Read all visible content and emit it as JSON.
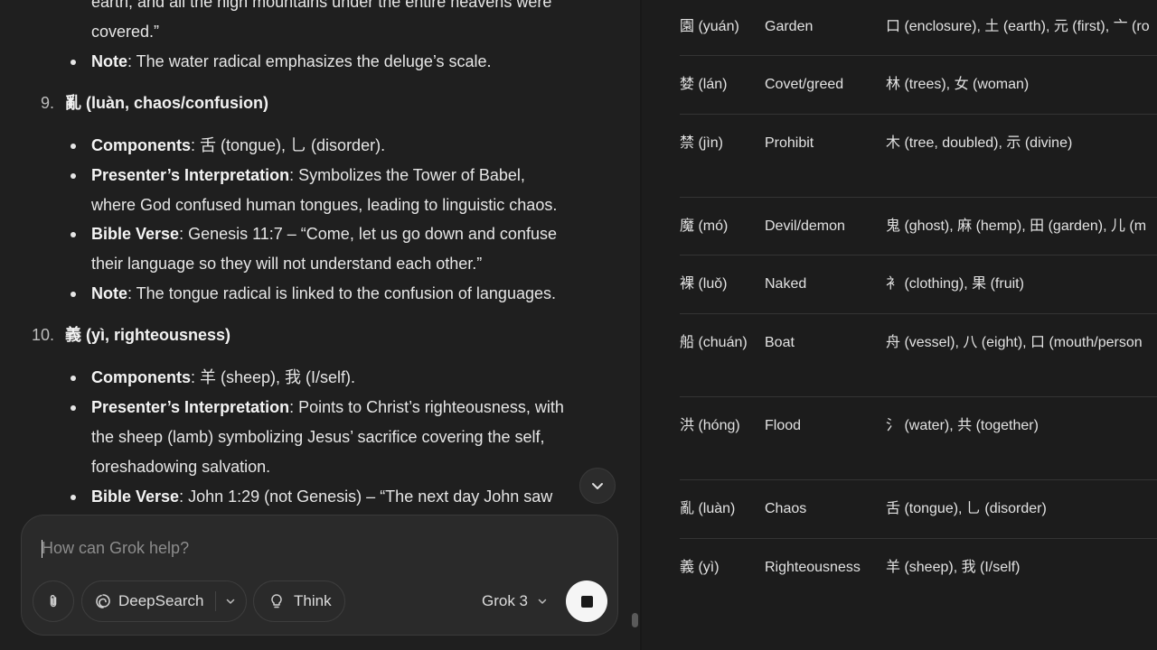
{
  "chat": {
    "lines": [
      {
        "type": "cont",
        "text": "earth, and all the high mountains under the entire heavens were"
      },
      {
        "type": "cont",
        "text": "covered.”"
      },
      {
        "type": "bullet",
        "label": "Note",
        "text": ": The water radical emphasizes the deluge’s scale."
      },
      {
        "type": "number",
        "num": "9.",
        "text": "亂 (luàn, chaos/confusion)"
      },
      {
        "type": "bullet",
        "label": "Components",
        "text": ": 舌 (tongue), 乚 (disorder)."
      },
      {
        "type": "bullet",
        "label": "Presenter’s Interpretation",
        "text": ": Symbolizes the Tower of Babel,"
      },
      {
        "type": "cont",
        "text": "where God confused human tongues, leading to linguistic chaos."
      },
      {
        "type": "bullet",
        "label": "Bible Verse",
        "text": ": Genesis 11:7 – “Come, let us go down and confuse"
      },
      {
        "type": "cont",
        "text": "their language so they will not understand each other.”"
      },
      {
        "type": "bullet",
        "label": "Note",
        "text": ": The tongue radical is linked to the confusion of languages."
      },
      {
        "type": "number",
        "num": "10.",
        "text": "義 (yì, righteousness)"
      },
      {
        "type": "bullet",
        "label": "Components",
        "text": ": 羊 (sheep), 我 (I/self)."
      },
      {
        "type": "bullet",
        "label": "Presenter’s Interpretation",
        "text": ": Points to Christ’s righteousness, with"
      },
      {
        "type": "cont",
        "text": "the sheep (lamb) symbolizing Jesus’ sacrifice covering the self,"
      },
      {
        "type": "cont",
        "text": "foreshadowing salvation."
      },
      {
        "type": "bullet",
        "label": "Bible Verse",
        "text": ": John 1:29 (not Genesis) – “The next day John saw"
      }
    ]
  },
  "composer": {
    "placeholder": "How can Grok help?",
    "deepsearch_label": "DeepSearch",
    "think_label": "Think",
    "model_label": "Grok 3"
  },
  "table": {
    "rows": [
      {
        "char": "園 (yuán)",
        "meaning": "Garden",
        "components": "口 (enclosure), 土 (earth), 元 (first), 亠 (ro"
      },
      {
        "char": "婪 (lán)",
        "meaning": "Covet/greed",
        "components": "林 (trees), 女 (woman)"
      },
      {
        "char": "禁 (jìn)",
        "meaning": "Prohibit",
        "components": "木 (tree, doubled), 示 (divine)"
      },
      {
        "char": "魔 (mó)",
        "meaning": "Devil/demon",
        "components": "鬼 (ghost), 麻 (hemp), 田 (garden), 儿 (m"
      },
      {
        "char": "裸 (luǒ)",
        "meaning": "Naked",
        "components": "衤 (clothing), 果 (fruit)"
      },
      {
        "char": "船 (chuán)",
        "meaning": "Boat",
        "components": "舟 (vessel), 八 (eight), 口 (mouth/person"
      },
      {
        "char": "洪 (hóng)",
        "meaning": "Flood",
        "components": "氵 (water), 共 (together)"
      },
      {
        "char": "亂 (luàn)",
        "meaning": "Chaos",
        "components": "舌 (tongue), 乚 (disorder)"
      },
      {
        "char": "義 (yì)",
        "meaning": "Righteousness",
        "components": "羊 (sheep), 我 (I/self)"
      }
    ]
  }
}
